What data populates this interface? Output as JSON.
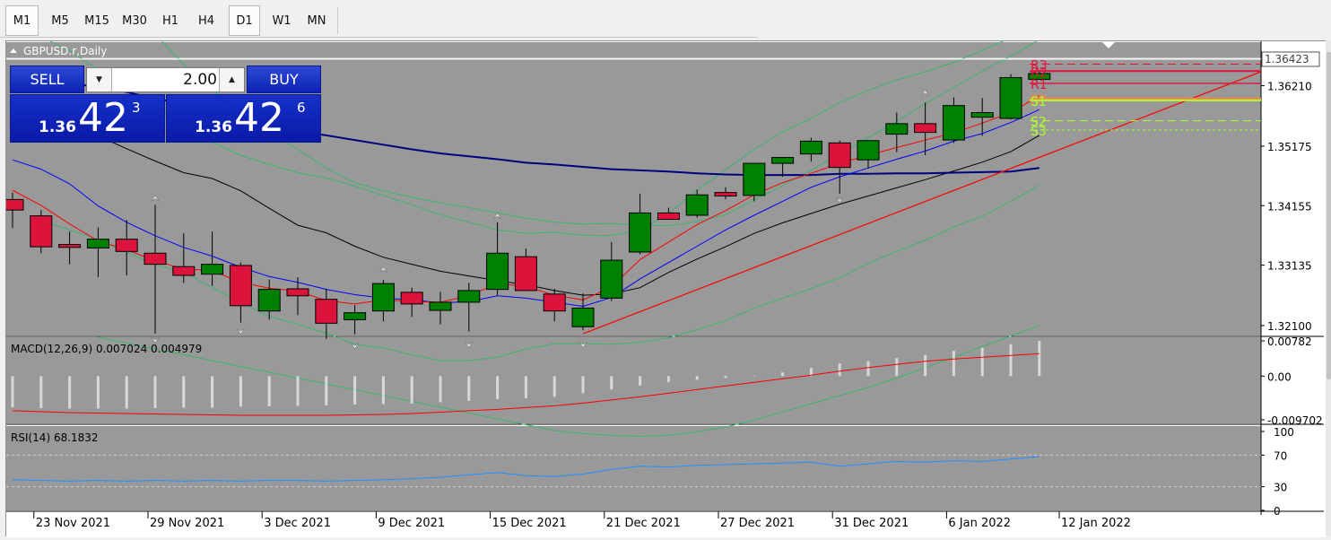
{
  "timeframes": [
    "M1",
    "M5",
    "M15",
    "M30",
    "H1",
    "H4",
    "D1",
    "W1",
    "MN"
  ],
  "active_timeframes": [
    "M1",
    "D1"
  ],
  "chart_title": "GBPUSD.r,Daily",
  "trade_panel": {
    "sell_label": "SELL",
    "buy_label": "BUY",
    "lot": "2.00",
    "sell_price": {
      "prefix": "1.36",
      "big": "42",
      "sup": "3"
    },
    "buy_price": {
      "prefix": "1.36",
      "big": "42",
      "sup": "6"
    }
  },
  "price_axis_labels": [
    "1.36210",
    "1.35175",
    "1.34155",
    "1.33135",
    "1.32100"
  ],
  "current_price_label": "1.36423",
  "pivot_labels": [
    "R3",
    "R2",
    "R1",
    "PP",
    "S1",
    "S2",
    "S3"
  ],
  "macd_label": "MACD(12,26,9) 0.007024 0.004979",
  "macd_axis_labels": [
    "0.00782",
    "0.00",
    "-0.009702"
  ],
  "rsi_label": "RSI(14) 68.1832",
  "rsi_axis_labels": [
    "100",
    "70",
    "30",
    "0"
  ],
  "date_labels": [
    "23 Nov 2021",
    "29 Nov 2021",
    "3 Dec 2021",
    "9 Dec 2021",
    "15 Dec 2021",
    "21 Dec 2021",
    "27 Dec 2021",
    "31 Dec 2021",
    "6 Jan 2022",
    "12 Jan 2022"
  ],
  "colors": {
    "background": "#999999",
    "bull_candle": "#008000",
    "bear_candle": "#dc143c",
    "trade_blue": "#0c22b4",
    "pivot_r": "#dc143c",
    "pivot_pp": "#ff8040",
    "pivot_s": "#adff2f",
    "ma_blue": "#0000ff",
    "ma_navy": "#000080",
    "ma_black": "#000000",
    "ma_red": "#ff0000",
    "bollinger_green": "#3cb371",
    "rsi_line": "#1e90ff"
  },
  "chart_data": {
    "type": "candlestick",
    "symbol": "GBPUSD.r",
    "timeframe": "Daily",
    "candles": [
      {
        "date": "2021-11-22",
        "open": 1.3426,
        "high": 1.3438,
        "low": 1.3377,
        "close": 1.3408
      },
      {
        "date": "2021-11-23",
        "open": 1.3398,
        "high": 1.3408,
        "low": 1.3334,
        "close": 1.3345
      },
      {
        "date": "2021-11-24",
        "open": 1.3349,
        "high": 1.3371,
        "low": 1.3315,
        "close": 1.3344
      },
      {
        "date": "2021-11-25",
        "open": 1.3343,
        "high": 1.3378,
        "low": 1.3293,
        "close": 1.3358
      },
      {
        "date": "2021-11-26",
        "open": 1.3358,
        "high": 1.3391,
        "low": 1.3296,
        "close": 1.3337
      },
      {
        "date": "2021-11-29",
        "open": 1.3334,
        "high": 1.3417,
        "low": 1.3196,
        "close": 1.3315
      },
      {
        "date": "2021-11-30",
        "open": 1.3311,
        "high": 1.3368,
        "low": 1.3283,
        "close": 1.3296
      },
      {
        "date": "2021-12-01",
        "open": 1.3298,
        "high": 1.3371,
        "low": 1.3278,
        "close": 1.3315
      },
      {
        "date": "2021-12-02",
        "open": 1.3313,
        "high": 1.3318,
        "low": 1.3215,
        "close": 1.3244
      },
      {
        "date": "2021-12-03",
        "open": 1.3235,
        "high": 1.3289,
        "low": 1.322,
        "close": 1.3272
      },
      {
        "date": "2021-12-06",
        "open": 1.3273,
        "high": 1.3293,
        "low": 1.3228,
        "close": 1.3261
      },
      {
        "date": "2021-12-07",
        "open": 1.3255,
        "high": 1.3273,
        "low": 1.3187,
        "close": 1.3214
      },
      {
        "date": "2021-12-08",
        "open": 1.322,
        "high": 1.3245,
        "low": 1.3195,
        "close": 1.3232
      },
      {
        "date": "2021-12-09",
        "open": 1.3235,
        "high": 1.3288,
        "low": 1.3217,
        "close": 1.3282
      },
      {
        "date": "2021-12-10",
        "open": 1.3267,
        "high": 1.3275,
        "low": 1.3225,
        "close": 1.3247
      },
      {
        "date": "2021-12-13",
        "open": 1.3236,
        "high": 1.3268,
        "low": 1.3212,
        "close": 1.325
      },
      {
        "date": "2021-12-14",
        "open": 1.325,
        "high": 1.3283,
        "low": 1.32,
        "close": 1.327
      },
      {
        "date": "2021-12-15",
        "open": 1.3272,
        "high": 1.3387,
        "low": 1.3262,
        "close": 1.3334
      },
      {
        "date": "2021-12-16",
        "open": 1.3328,
        "high": 1.3342,
        "low": 1.3273,
        "close": 1.327
      },
      {
        "date": "2021-12-17",
        "open": 1.3264,
        "high": 1.3273,
        "low": 1.3217,
        "close": 1.3235
      },
      {
        "date": "2021-12-20",
        "open": 1.3208,
        "high": 1.3265,
        "low": 1.3202,
        "close": 1.324
      },
      {
        "date": "2021-12-21",
        "open": 1.3257,
        "high": 1.3353,
        "low": 1.3252,
        "close": 1.3322
      },
      {
        "date": "2021-12-22",
        "open": 1.3336,
        "high": 1.3436,
        "low": 1.3332,
        "close": 1.3403
      },
      {
        "date": "2021-12-23",
        "open": 1.3403,
        "high": 1.3412,
        "low": 1.3394,
        "close": 1.3392
      },
      {
        "date": "2021-12-24",
        "open": 1.3399,
        "high": 1.3443,
        "low": 1.3395,
        "close": 1.3434
      },
      {
        "date": "2021-12-27",
        "open": 1.3438,
        "high": 1.3447,
        "low": 1.3426,
        "close": 1.3432
      },
      {
        "date": "2021-12-28",
        "open": 1.3433,
        "high": 1.3486,
        "low": 1.3423,
        "close": 1.3488
      },
      {
        "date": "2021-12-29",
        "open": 1.3488,
        "high": 1.3498,
        "low": 1.3465,
        "close": 1.3498
      },
      {
        "date": "2021-12-30",
        "open": 1.3504,
        "high": 1.3532,
        "low": 1.3491,
        "close": 1.3526
      },
      {
        "date": "2021-12-31",
        "open": 1.3523,
        "high": 1.3527,
        "low": 1.3436,
        "close": 1.3481
      },
      {
        "date": "2022-01-03",
        "open": 1.3494,
        "high": 1.3525,
        "low": 1.3479,
        "close": 1.3527
      },
      {
        "date": "2022-01-04",
        "open": 1.3538,
        "high": 1.3575,
        "low": 1.3507,
        "close": 1.3556
      },
      {
        "date": "2022-01-05",
        "open": 1.3556,
        "high": 1.3592,
        "low": 1.3502,
        "close": 1.3541
      },
      {
        "date": "2022-01-06",
        "open": 1.3528,
        "high": 1.3601,
        "low": 1.3523,
        "close": 1.3587
      },
      {
        "date": "2022-01-07",
        "open": 1.3567,
        "high": 1.36,
        "low": 1.3535,
        "close": 1.3575
      },
      {
        "date": "2022-01-10",
        "open": 1.3565,
        "high": 1.3641,
        "low": 1.3563,
        "close": 1.3635
      },
      {
        "date": "2022-01-11",
        "open": 1.3632,
        "high": 1.3647,
        "low": 1.3631,
        "close": 1.3642
      }
    ],
    "pivots": {
      "R3": 1.3658,
      "R2": 1.3646,
      "R1": 1.3625,
      "PP": 1.3599,
      "S1": 1.3596,
      "S2": 1.3561,
      "S3": 1.3545
    },
    "ma_overlays": {
      "black": [
        1.3588,
        1.3578,
        1.3562,
        1.3535,
        1.3513,
        1.3492,
        1.3472,
        1.3462,
        1.3441,
        1.3411,
        1.3382,
        1.3369,
        1.3346,
        1.3327,
        1.3315,
        1.3303,
        1.3295,
        1.3287,
        1.328,
        1.327,
        1.3262,
        1.3264,
        1.3275,
        1.3301,
        1.3324,
        1.3345,
        1.3368,
        1.3386,
        1.3402,
        1.3418,
        1.3432,
        1.3446,
        1.346,
        1.3475,
        1.349,
        1.3508,
        1.3536
      ],
      "navy": [
        1.3642,
        1.3636,
        1.3626,
        1.3618,
        1.361,
        1.3599,
        1.359,
        1.3578,
        1.3564,
        1.3552,
        1.3543,
        1.3536,
        1.3528,
        1.352,
        1.3512,
        1.3505,
        1.35,
        1.3495,
        1.3489,
        1.3486,
        1.3482,
        1.3478,
        1.3476,
        1.3474,
        1.3471,
        1.3469,
        1.3468,
        1.3468,
        1.3468,
        1.347,
        1.347,
        1.3471,
        1.3471,
        1.3472,
        1.3473,
        1.3474,
        1.348
      ],
      "blue": [
        1.3494,
        1.3478,
        1.3453,
        1.3415,
        1.3387,
        1.3364,
        1.3344,
        1.3329,
        1.331,
        1.3294,
        1.3284,
        1.3272,
        1.3263,
        1.3257,
        1.3254,
        1.3249,
        1.3251,
        1.3261,
        1.3257,
        1.325,
        1.3243,
        1.3258,
        1.329,
        1.3318,
        1.3346,
        1.3374,
        1.3399,
        1.3423,
        1.3447,
        1.3465,
        1.348,
        1.3495,
        1.3509,
        1.3526,
        1.3539,
        1.3558,
        1.358
      ],
      "red": [
        1.3442,
        1.3416,
        1.3384,
        1.3355,
        1.334,
        1.3321,
        1.3307,
        1.3304,
        1.3284,
        1.3274,
        1.3269,
        1.3253,
        1.3247,
        1.3254,
        1.3251,
        1.325,
        1.3261,
        1.3282,
        1.3277,
        1.3262,
        1.3254,
        1.3276,
        1.3323,
        1.3353,
        1.3383,
        1.3407,
        1.3434,
        1.3455,
        1.3471,
        1.3488,
        1.3502,
        1.3515,
        1.3528,
        1.354,
        1.3557,
        1.3575,
        1.3604
      ]
    },
    "bollinger": {
      "upper": [
        1.3705,
        1.3681,
        1.3649,
        1.3613,
        1.3585,
        1.3552,
        1.3524,
        1.3502,
        1.3486,
        1.3472,
        1.3463,
        1.3449,
        1.3433,
        1.3417,
        1.34,
        1.3387,
        1.3374,
        1.3368,
        1.337,
        1.3365,
        1.3364,
        1.3374,
        1.3402,
        1.3442,
        1.3477,
        1.3512,
        1.3542,
        1.3565,
        1.3592,
        1.3613,
        1.3631,
        1.3645,
        1.3661,
        1.3682,
        1.3703,
        1.3719
      ],
      "lower": [
        1.339,
        1.3374,
        1.3357,
        1.3336,
        1.3314,
        1.3302,
        1.3275,
        1.3249,
        1.3226,
        1.3212,
        1.3197,
        1.3178,
        1.3172,
        1.316,
        1.315,
        1.315,
        1.3156,
        1.317,
        1.3179,
        1.3179,
        1.3178,
        1.3181,
        1.3189,
        1.3203,
        1.3218,
        1.324,
        1.3257,
        1.3273,
        1.3292,
        1.3317,
        1.3337,
        1.3356,
        1.3379,
        1.3397,
        1.3423,
        1.345
      ],
      "upper_outer": [
        1.38,
        1.3762,
        1.371,
        1.3658,
        1.3614,
        1.3576,
        1.3541,
        1.3512,
        1.348,
        1.3455,
        1.3441,
        1.343,
        1.342,
        1.3412,
        1.3403,
        1.3394,
        1.3387,
        1.3384,
        1.3385,
        1.3382,
        1.3381,
        1.3388,
        1.34,
        1.3425,
        1.345,
        1.3476,
        1.3505,
        1.3532,
        1.356,
        1.359,
        1.3618,
        1.3646,
        1.3672,
        1.37,
        1.3725,
        1.375
      ],
      "lower_outer": [
        1.319,
        1.318,
        1.317,
        1.316,
        1.315,
        1.314,
        1.313,
        1.312,
        1.311,
        1.31,
        1.309,
        1.308,
        1.307,
        1.306,
        1.305,
        1.304,
        1.303,
        1.3025,
        1.3022,
        1.302,
        1.3022,
        1.3028,
        1.3036,
        1.3048,
        1.3062,
        1.3076,
        1.309,
        1.3104,
        1.312,
        1.3138,
        1.3156,
        1.3174,
        1.3192,
        1.321
      ]
    },
    "trendline": [
      {
        "date": "2021-12-20",
        "price": 1.3196
      },
      {
        "date": "2022-01-12",
        "price": 1.3645
      }
    ],
    "fractals_up": [
      {
        "date": "2021-11-29",
        "price": 1.3417
      },
      {
        "date": "2021-12-09",
        "price": 1.3295
      },
      {
        "date": "2021-12-15",
        "price": 1.3387
      },
      {
        "date": "2022-01-05",
        "price": 1.3598
      }
    ],
    "fractals_down": [
      {
        "date": "2021-11-29",
        "price": 1.3196
      },
      {
        "date": "2021-12-02",
        "price": 1.3211
      },
      {
        "date": "2021-12-08",
        "price": 1.3186
      },
      {
        "date": "2021-12-14",
        "price": 1.3188
      },
      {
        "date": "2021-12-20",
        "price": 1.3188
      },
      {
        "date": "2021-12-31",
        "price": 1.3436
      }
    ],
    "price_ylim": [
      1.3193,
      1.3668
    ],
    "macd": {
      "histogram": [
        -0.0069,
        -0.0071,
        -0.0072,
        -0.0072,
        -0.0072,
        -0.0071,
        -0.007,
        -0.007,
        -0.0068,
        -0.0067,
        -0.0066,
        -0.0065,
        -0.0063,
        -0.0062,
        -0.0061,
        -0.0058,
        -0.0055,
        -0.0051,
        -0.0049,
        -0.0046,
        -0.0038,
        -0.003,
        -0.0021,
        -0.0013,
        -0.0008,
        -0.0004,
        0.0001,
        0.0008,
        0.0018,
        0.0028,
        0.0033,
        0.004,
        0.0047,
        0.0056,
        0.0063,
        0.0071,
        0.0078
      ],
      "signal": [
        -0.0077,
        -0.0079,
        -0.0081,
        -0.0082,
        -0.0083,
        -0.0084,
        -0.0085,
        -0.0086,
        -0.0087,
        -0.0087,
        -0.0087,
        -0.0087,
        -0.0086,
        -0.0085,
        -0.0083,
        -0.008,
        -0.0077,
        -0.0074,
        -0.007,
        -0.0066,
        -0.006,
        -0.0053,
        -0.0046,
        -0.0038,
        -0.003,
        -0.0022,
        -0.0014,
        -0.0006,
        0.0002,
        0.0011,
        0.0019,
        0.0026,
        0.0033,
        0.0038,
        0.0042,
        0.0046,
        0.005
      ],
      "ylim": [
        -0.009702,
        0.00782
      ]
    },
    "rsi": {
      "values": [
        39,
        38,
        37,
        38,
        37,
        38,
        37,
        38,
        37,
        38,
        38,
        37,
        38,
        39,
        40,
        42,
        45,
        48,
        44,
        43,
        46,
        52,
        56,
        55,
        57,
        58,
        59,
        60,
        61,
        56,
        59,
        62,
        61,
        63,
        62,
        65,
        68.18
      ],
      "levels": [
        70,
        30
      ],
      "ylim": [
        0,
        100
      ]
    }
  }
}
